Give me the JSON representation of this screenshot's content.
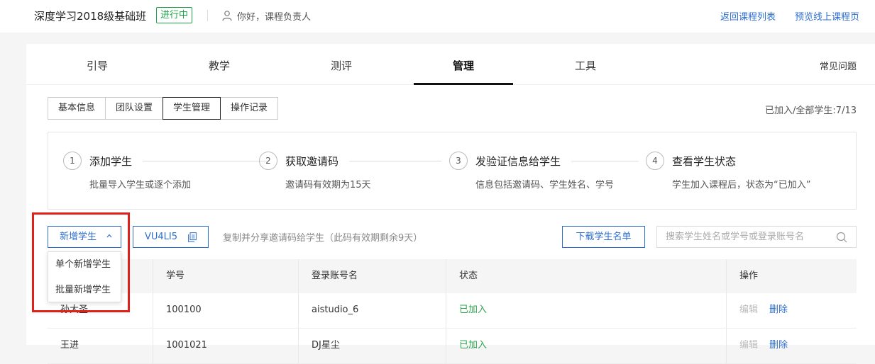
{
  "header": {
    "course_title": "深度学习2018级基础班",
    "status_badge": "进行中",
    "greeting": "你好，课程负责人",
    "back_link": "返回课程列表",
    "preview_link": "预览线上课程页"
  },
  "nav": {
    "tabs": [
      "引导",
      "教学",
      "测评",
      "管理",
      "工具"
    ],
    "active_index": 3,
    "faq": "常见问题"
  },
  "subtabs": {
    "items": [
      "基本信息",
      "团队设置",
      "学生管理",
      "操作记录"
    ],
    "active_index": 2,
    "joined_count": "已加入/全部学生:7/13"
  },
  "steps": [
    {
      "num": "1",
      "title": "添加学生",
      "desc": "批量导入学生或逐个添加"
    },
    {
      "num": "2",
      "title": "获取邀请码",
      "desc": "邀请码有效期为15天"
    },
    {
      "num": "3",
      "title": "发验证信息给学生",
      "desc": "信息包括邀请码、学生姓名、学号"
    },
    {
      "num": "4",
      "title": "查看学生状态",
      "desc": "学生加入课程后，状态为“已加入”"
    }
  ],
  "toolbar": {
    "add_label": "新增学生",
    "invite_code": "VU4LI5",
    "invite_hint": "复制并分享邀请码给学生（此码有效期剩余9天）",
    "download_label": "下载学生名单",
    "search_placeholder": "搜索学生姓名或学号或登录账号名"
  },
  "dropdown": {
    "options": [
      "单个新增学生",
      "批量新增学生"
    ]
  },
  "table": {
    "columns": [
      "",
      "学号",
      "登录账号名",
      "状态",
      "操作"
    ],
    "rows": [
      {
        "name": "孙大圣",
        "id": "100100",
        "account": "aistudio_6",
        "status": "已加入",
        "edit": "编辑",
        "delete": "删除"
      },
      {
        "name": "王进",
        "id": "1001021",
        "account": "DJ星尘",
        "status": "已加入",
        "edit": "编辑",
        "delete": "删除"
      }
    ]
  },
  "colors": {
    "accent": "#2d6fd1",
    "success": "#2ea44f",
    "highlight": "#e0201b"
  }
}
